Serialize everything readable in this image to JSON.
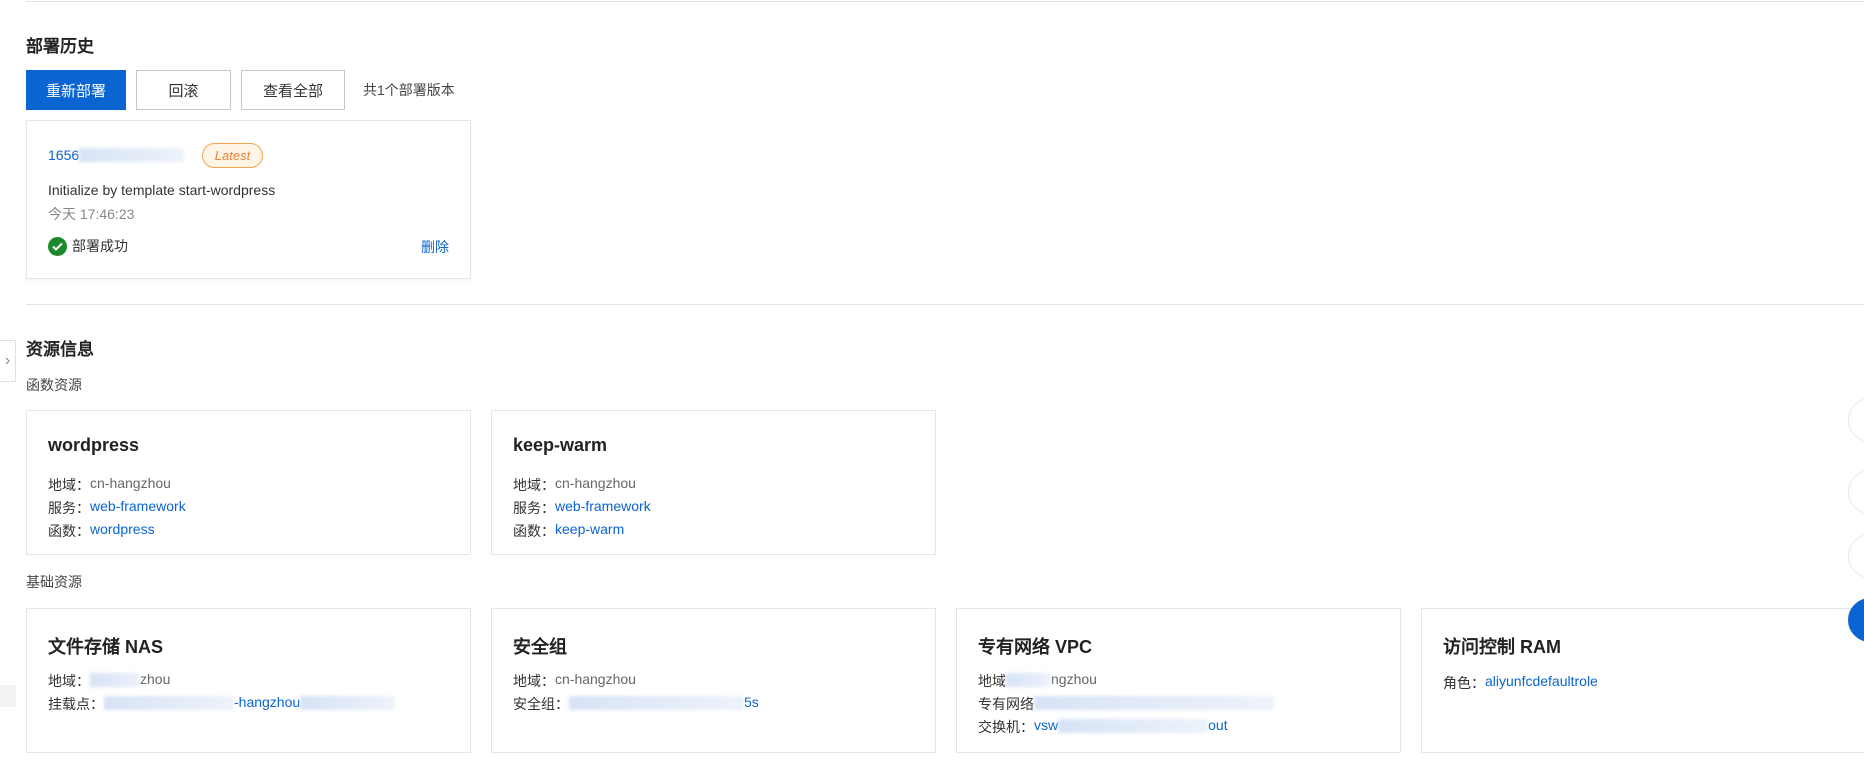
{
  "deploy_history": {
    "title": "部署历史",
    "redeploy_label": "重新部署",
    "rollback_label": "回滚",
    "view_all_label": "查看全部",
    "count_text": "共1个部署版本",
    "record": {
      "id_prefix": "1656",
      "badge": "Latest",
      "description": "Initialize by template start-wordpress",
      "time": "今天 17:46:23",
      "status": "部署成功",
      "delete_label": "删除"
    }
  },
  "resource_info": {
    "title": "资源信息",
    "function_section_label": "函数资源",
    "functions": [
      {
        "name": "wordpress",
        "region_label": "地域：",
        "region": "cn-hangzhou",
        "service_label": "服务：",
        "service": "web-framework",
        "function_label": "函数：",
        "function": "wordpress"
      },
      {
        "name": "keep-warm",
        "region_label": "地域：",
        "region": "cn-hangzhou",
        "service_label": "服务：",
        "service": "web-framework",
        "function_label": "函数：",
        "function": "keep-warm"
      }
    ],
    "base_section_label": "基础资源",
    "base": {
      "nas": {
        "name": "文件存储 NAS",
        "region_label": "地域：",
        "region_visible": "zhou",
        "mount_label": "挂载点：",
        "mount_visible": "-hangzhou"
      },
      "sg": {
        "name": "安全组",
        "region_label": "地域：",
        "region": "cn-hangzhou",
        "sg_label": "安全组：",
        "sg_visible": "5s"
      },
      "vpc": {
        "name": "专有网络 VPC",
        "region_label": "地域",
        "region_visible": "ngzhou",
        "vpc_label": "专有网络",
        "vswitch_label": "交换机：",
        "vswitch_prefix": "vsw",
        "vswitch_suffix": "out"
      },
      "ram": {
        "name": "访问控制 RAM",
        "role_label": "角色：",
        "role": "aliyunfcdefaultrole"
      }
    }
  },
  "colors": {
    "primary": "#0a64d1",
    "success": "#1a8a2a",
    "badge": "#e8853a"
  },
  "icons": {
    "status": "check-circle-icon",
    "expand": "chevron-right-icon"
  }
}
